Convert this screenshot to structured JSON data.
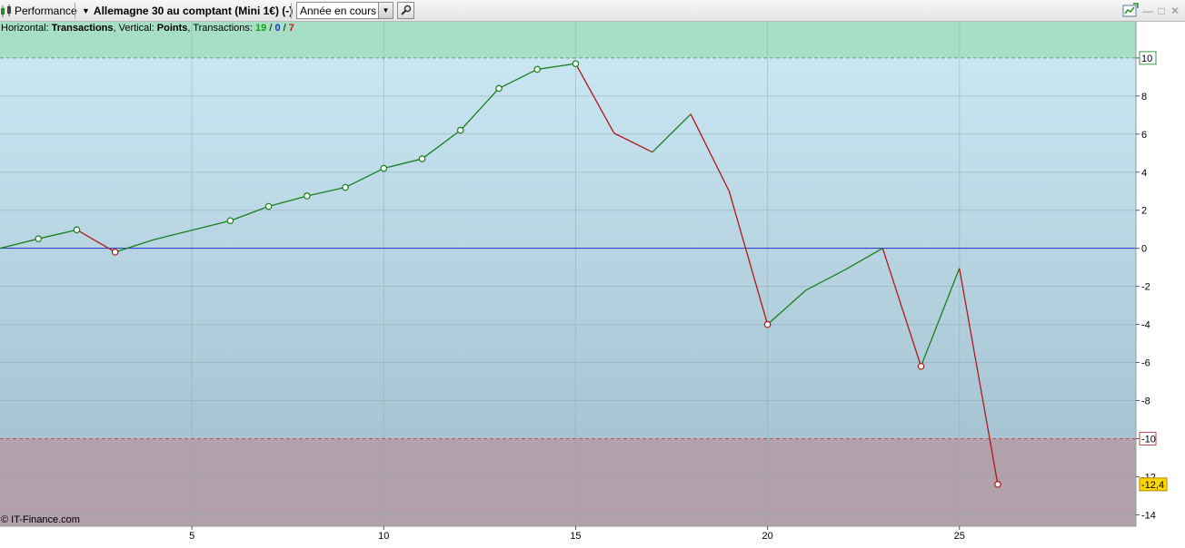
{
  "toolbar": {
    "performance_label": "Performance",
    "instrument_label": "Allemagne 30 au comptant (Mini 1€) (-)",
    "period_selected": "Année en cours",
    "tool_icon": "wrench-icon",
    "window_controls": [
      "minimize-icon",
      "maximize-icon",
      "close-icon"
    ]
  },
  "info": {
    "horizontal_label": "Horizontal: ",
    "horizontal_value": "Transactions",
    "vertical_label": ", Vertical: ",
    "vertical_value": "Points",
    "transactions_label": ", Transactions: ",
    "win_count": "19",
    "slash1": " / ",
    "neutral_count": "0",
    "slash2": " / ",
    "loss_count": "7"
  },
  "copyright": "© IT-Finance.com",
  "chart_data": {
    "type": "line",
    "title": "",
    "xlabel": "",
    "ylabel": "",
    "x": [
      0,
      1,
      2,
      3,
      4,
      5,
      6,
      7,
      8,
      9,
      10,
      11,
      12,
      13,
      14,
      15,
      16,
      17,
      18,
      19,
      20,
      21,
      22,
      23,
      24,
      25,
      26
    ],
    "values": [
      0,
      0.5,
      0.97,
      -0.2,
      0.45,
      0.95,
      1.45,
      2.2,
      2.75,
      3.2,
      4.2,
      4.7,
      6.2,
      8.4,
      9.4,
      9.7,
      6.05,
      5.05,
      7.05,
      3.0,
      -4.0,
      -2.2,
      -1.15,
      0.0,
      -6.2,
      -1.05,
      -12.4
    ],
    "markers": [
      1,
      2,
      3,
      6,
      7,
      8,
      9,
      10,
      11,
      12,
      13,
      14,
      15,
      20,
      24,
      26
    ],
    "last_value_label": "-12,4",
    "xlim": [
      0,
      29.6
    ],
    "ylim": [
      -14.6,
      11.9
    ],
    "x_ticks": [
      5,
      10,
      15,
      20,
      25
    ],
    "y_ticks": [
      -14,
      -12,
      -10,
      -8,
      -6,
      -4,
      -2,
      0,
      2,
      4,
      6,
      8,
      10
    ],
    "upper_threshold": 10,
    "lower_threshold": -10,
    "zero_line": 0,
    "grid": true,
    "colors": {
      "up": "#1a7f1a",
      "down": "#b01818",
      "zero_line": "#1c2fcf",
      "upper_zone": "#a6dfc6",
      "lower_zone": "#b2a1ab",
      "bg_top": "#cde9f6",
      "bg_bottom": "#9fbccb",
      "last_label_bg": "#ffd700"
    }
  }
}
